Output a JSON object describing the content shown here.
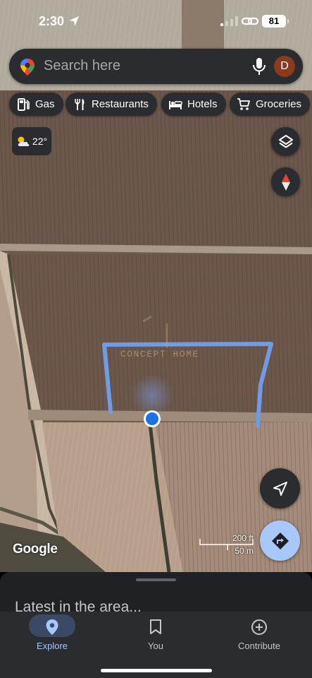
{
  "status_bar": {
    "time": "2:30",
    "battery": "81"
  },
  "search": {
    "placeholder": "Search here",
    "avatar_letter": "D"
  },
  "chips": [
    {
      "label": "Gas",
      "icon": "gas-station-icon"
    },
    {
      "label": "Restaurants",
      "icon": "fork-knife-icon"
    },
    {
      "label": "Hotels",
      "icon": "bed-icon"
    },
    {
      "label": "Groceries",
      "icon": "cart-icon"
    }
  ],
  "weather": {
    "temp": "22°",
    "icon": "partly-cloudy-icon"
  },
  "map": {
    "watermark": "CONCEPT HOME",
    "attribution": "Google",
    "scale_ft": "200 ft",
    "scale_m": "50 m",
    "boundary_color": "#6f9ce6",
    "location_dot_color": "#1a73e8"
  },
  "sheet": {
    "title": "Latest in the area..."
  },
  "nav": {
    "items": [
      {
        "label": "Explore",
        "icon": "location-pin-icon",
        "active": true
      },
      {
        "label": "You",
        "icon": "bookmark-icon",
        "active": false
      },
      {
        "label": "Contribute",
        "icon": "plus-circle-icon",
        "active": false
      }
    ]
  },
  "colors": {
    "accent": "#a8c7fa",
    "surface": "#2b2c30",
    "directions_button": "#a8c7fa"
  }
}
